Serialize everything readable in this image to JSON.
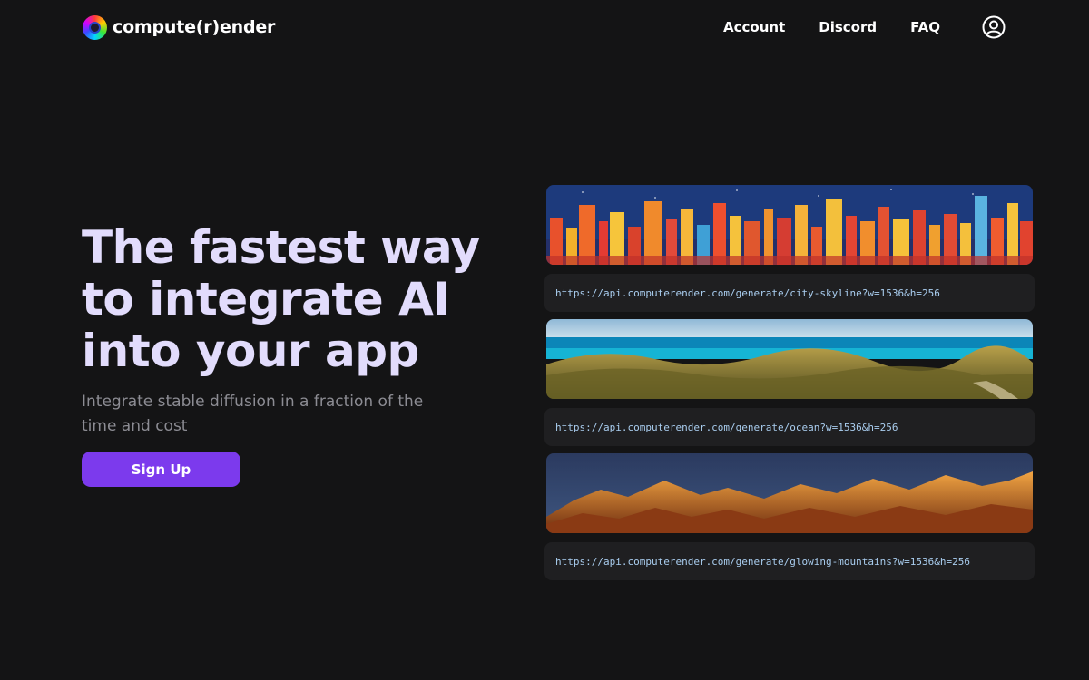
{
  "brand": {
    "name": "compute(r)ender"
  },
  "nav": {
    "links": [
      "Account",
      "Discord",
      "FAQ"
    ]
  },
  "hero": {
    "headline_lines": [
      "The fastest way",
      "to integrate AI",
      "into your app"
    ],
    "subhead": "Integrate stable diffusion in a fraction of the time and cost",
    "cta_label": "Sign Up"
  },
  "gallery": [
    {
      "image": "city-skyline",
      "url": "https://api.computerender.com/generate/city-skyline?w=1536&h=256"
    },
    {
      "image": "ocean",
      "url": "https://api.computerender.com/generate/ocean?w=1536&h=256"
    },
    {
      "image": "glowing-mountains",
      "url": "https://api.computerender.com/generate/glowing-mountains?w=1536&h=256"
    }
  ],
  "colors": {
    "background": "#141415",
    "headline": "#e2dcfc",
    "accent": "#7c3aed",
    "url_text": "#a9cdef"
  },
  "icons": {
    "account": "user-circle-icon",
    "logo": "rainbow-ring-logo"
  }
}
